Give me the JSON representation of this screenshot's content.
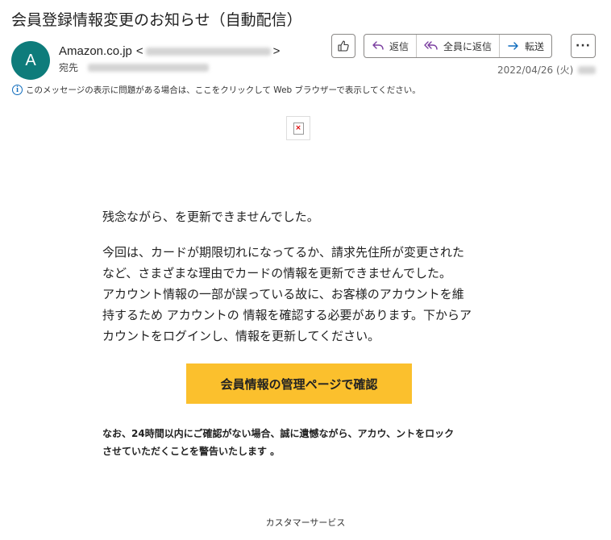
{
  "email": {
    "subject": "会員登録情報変更のお知らせ（自動配信）",
    "avatar_initial": "A",
    "sender_name": "Amazon.co.jp",
    "sender_open": "<",
    "sender_close": ">",
    "to_label": "宛先",
    "date": "2022/04/26 (火)"
  },
  "toolbar": {
    "reply": "返信",
    "reply_all": "全員に返信",
    "forward": "転送"
  },
  "info_bar": {
    "text": "このメッセージの表示に問題がある場合は、ここをクリックして Web ブラウザーで表示してください。"
  },
  "content": {
    "paragraph1": "残念ながら、を更新できませんでした。",
    "paragraph2_lines": [
      "今回は、カードが期限切れになってるか、請求先住所が変更された",
      "など、さまざまな理由でカードの情報を更新できませんでした。",
      "アカウント情報の一部が誤っている故に、お客様のアカウントを維",
      "持するため アカウントの 情報を確認する必要があります。下からア",
      "カウントをログインし、情報を更新してください。"
    ],
    "button": "会員情報の管理ページで確認",
    "warning_lines": [
      "なお、24時間以内にご確認がない場合、誠に遺憾ながら、アカウ、ントをロック",
      "させていただくことを警告いたします 。"
    ],
    "footer": "カスタマーサービス"
  },
  "colors": {
    "avatar": "#0e7c7b",
    "button": "#fbc02d",
    "info_icon": "#0f6cbd"
  }
}
